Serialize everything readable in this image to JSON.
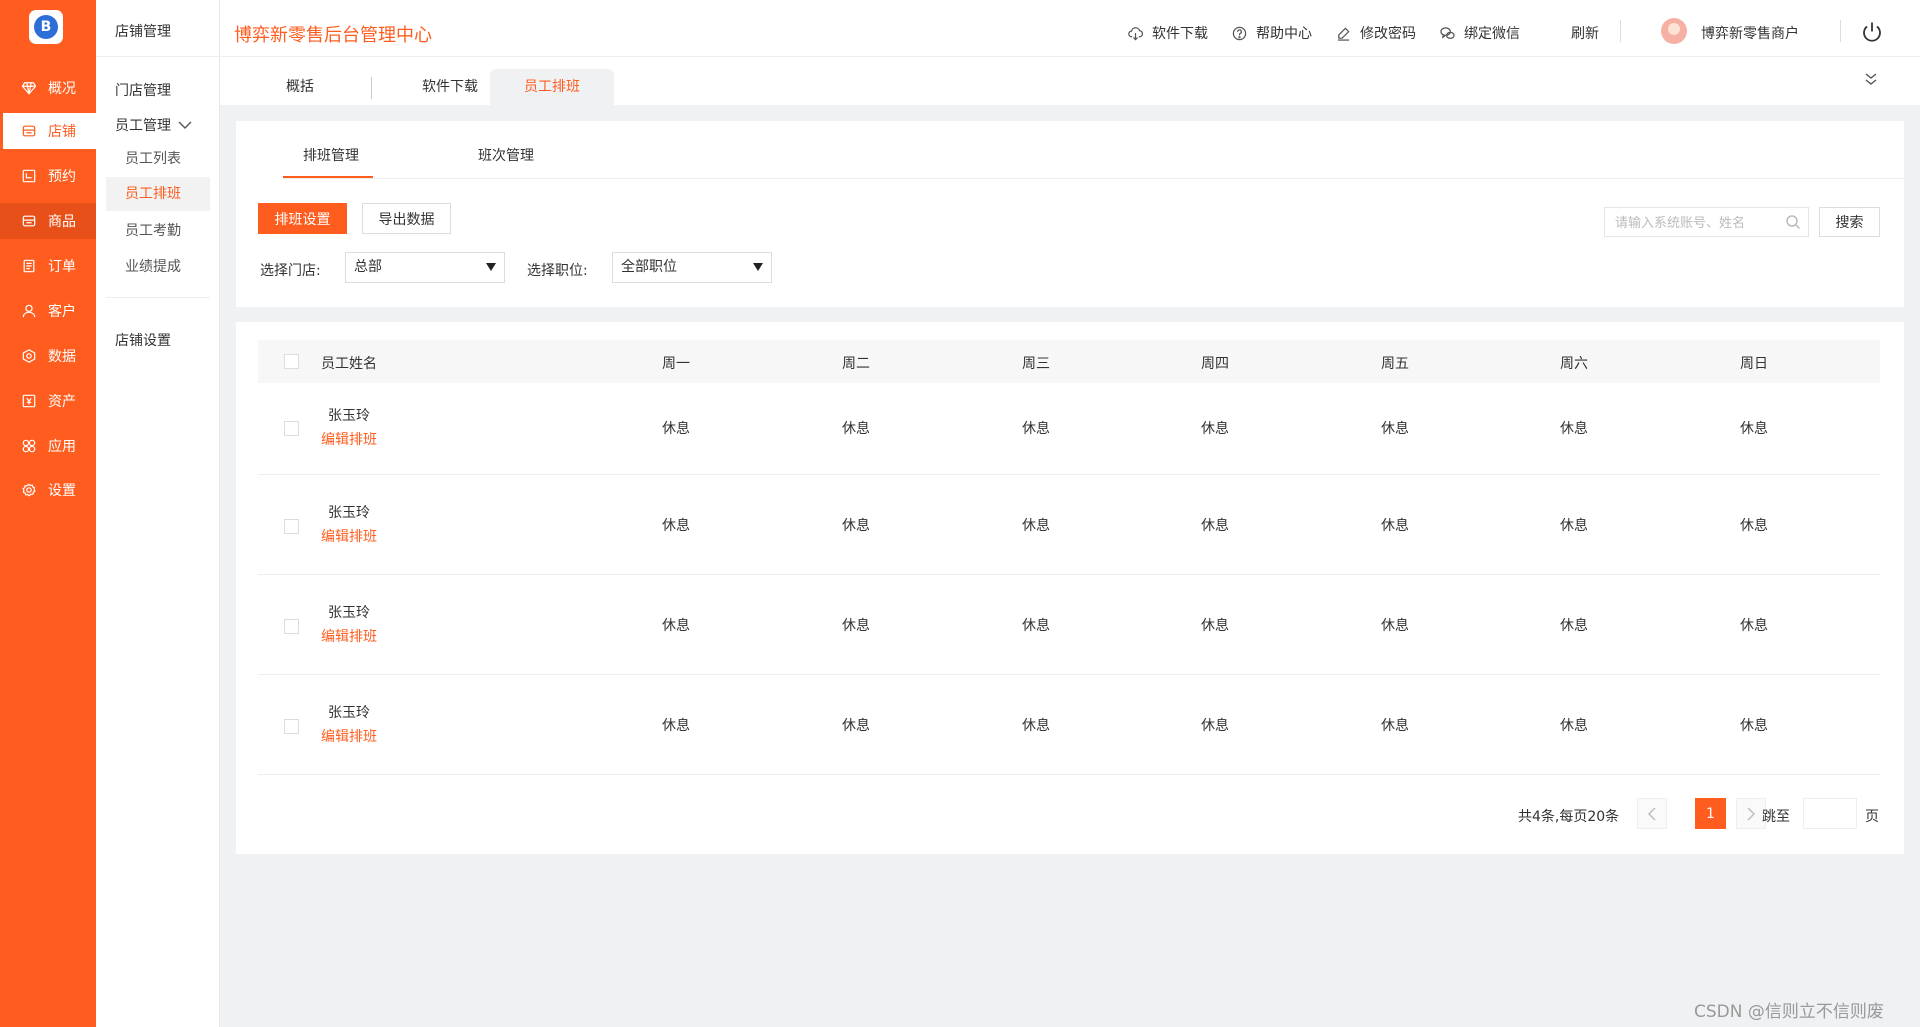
{
  "app": {
    "logo_letter": "B",
    "brand": "博弈新零售后台管理中心",
    "accent": "#ff5d1f"
  },
  "rail": {
    "items": [
      {
        "label": "概况",
        "icon": "diamond-icon"
      },
      {
        "label": "店铺",
        "icon": "store-icon"
      },
      {
        "label": "预约",
        "icon": "calendar-icon"
      },
      {
        "label": "商品",
        "icon": "box-icon"
      },
      {
        "label": "订单",
        "icon": "order-icon"
      },
      {
        "label": "客户",
        "icon": "user-icon"
      },
      {
        "label": "数据",
        "icon": "data-icon"
      },
      {
        "label": "资产",
        "icon": "asset-icon"
      },
      {
        "label": "应用",
        "icon": "apps-icon"
      },
      {
        "label": "设置",
        "icon": "gear-icon"
      }
    ]
  },
  "submenu": {
    "title": "店铺管理",
    "store_mgmt": "门店管理",
    "staff_mgmt": "员工管理",
    "staff_list": "员工列表",
    "staff_schedule": "员工排班",
    "staff_attendance": "员工考勤",
    "performance": "业绩提成",
    "store_settings": "店铺设置"
  },
  "header": {
    "download": "软件下载",
    "help": "帮助中心",
    "password": "修改密码",
    "wechat": "绑定微信",
    "refresh": "刷新",
    "merchant": "博弈新零售商户"
  },
  "tabs": {
    "overview": "概括",
    "download": "软件下载",
    "schedule": "员工排班"
  },
  "filters": {
    "subtab_schedule": "排班管理",
    "subtab_shift": "班次管理",
    "btn_schedule_settings": "排班设置",
    "btn_export": "导出数据",
    "search_placeholder": "请输入系统账号、姓名",
    "btn_search": "搜索",
    "store_label": "选择门店:",
    "store_value": "总部",
    "position_label": "选择职位:",
    "position_value": "全部职位"
  },
  "table": {
    "headers": {
      "name": "员工姓名",
      "mon": "周一",
      "tue": "周二",
      "wed": "周三",
      "thu": "周四",
      "fri": "周五",
      "sat": "周六",
      "sun": "周日"
    },
    "edit_label": "编辑排班",
    "rows": [
      {
        "name": "张玉玲",
        "days": [
          "休息",
          "休息",
          "休息",
          "休息",
          "休息",
          "休息",
          "休息"
        ]
      },
      {
        "name": "张玉玲",
        "days": [
          "休息",
          "休息",
          "休息",
          "休息",
          "休息",
          "休息",
          "休息"
        ]
      },
      {
        "name": "张玉玲",
        "days": [
          "休息",
          "休息",
          "休息",
          "休息",
          "休息",
          "休息",
          "休息"
        ]
      },
      {
        "name": "张玉玲",
        "days": [
          "休息",
          "休息",
          "休息",
          "休息",
          "休息",
          "休息",
          "休息"
        ]
      }
    ]
  },
  "pagination": {
    "total": "共4条,每页20条",
    "current": "1",
    "jump_label": "跳至",
    "jump_value": "",
    "unit": "页"
  },
  "watermark": "CSDN @信则立不信则废"
}
